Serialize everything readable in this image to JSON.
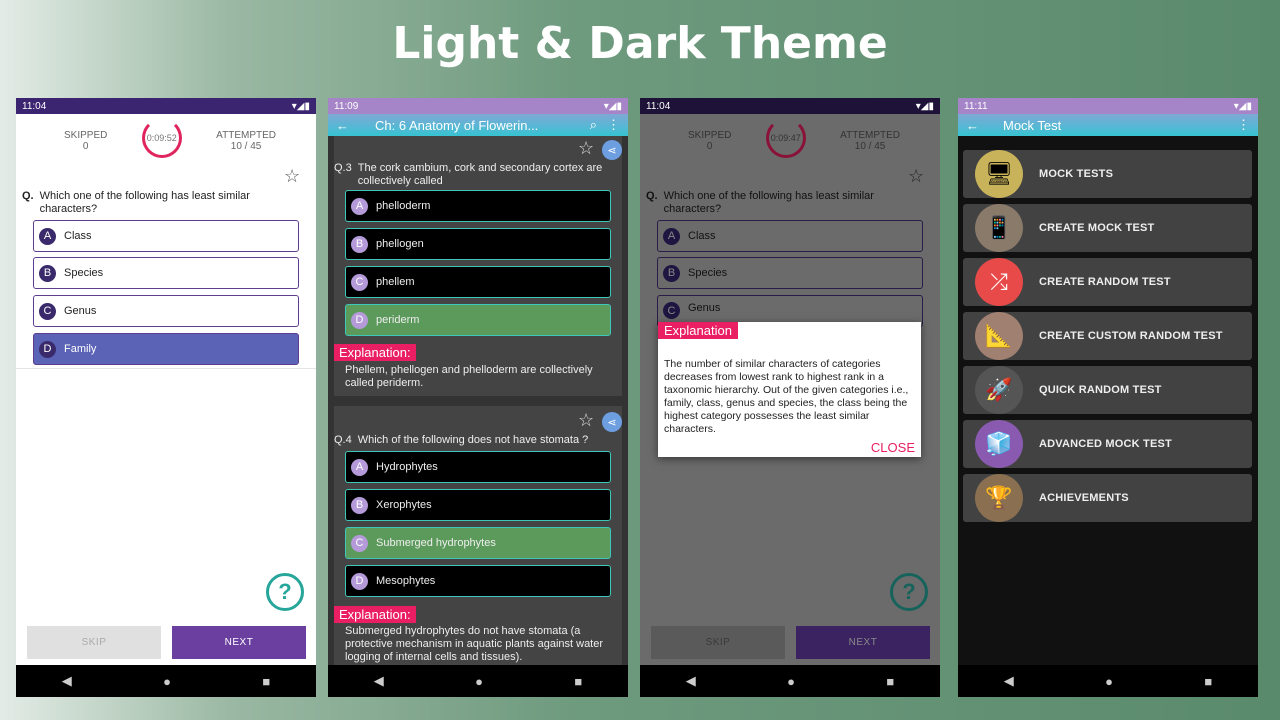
{
  "hero_title": "Light & Dark Theme",
  "screens": {
    "s1": {
      "time": "11:04",
      "skipped_label": "SKIPPED",
      "skipped_value": "0",
      "timer": "0:09:52",
      "attempted_label": "ATTEMPTED",
      "attempted_value": "10 / 45",
      "q_prefix": "Q.",
      "question": "Which one of the following has least similar characters?",
      "options": [
        {
          "letter": "A",
          "text": "Class"
        },
        {
          "letter": "B",
          "text": "Species"
        },
        {
          "letter": "C",
          "text": "Genus"
        },
        {
          "letter": "D",
          "text": "Family",
          "selected": true
        }
      ],
      "skip": "SKIP",
      "next": "NEXT",
      "help": "?"
    },
    "s2": {
      "time": "11:09",
      "title": "Ch: 6 Anatomy of Flowerin...",
      "q3": {
        "num": "Q.3",
        "text": "The cork cambium, cork and secondary cortex are collectively called",
        "options": [
          {
            "letter": "A",
            "text": "phelloderm"
          },
          {
            "letter": "B",
            "text": "phellogen"
          },
          {
            "letter": "C",
            "text": "phellem"
          },
          {
            "letter": "D",
            "text": "periderm",
            "correct": true
          }
        ],
        "explanation_label": "Explanation:",
        "explanation": "Phellem, phellogen and phelloderm are collectively called periderm."
      },
      "q4": {
        "num": "Q.4",
        "text": "Which of the following does not have stomata ?",
        "options": [
          {
            "letter": "A",
            "text": "Hydrophytes"
          },
          {
            "letter": "B",
            "text": "Xerophytes"
          },
          {
            "letter": "C",
            "text": "Submerged hydrophytes",
            "correct": true
          },
          {
            "letter": "D",
            "text": "Mesophytes"
          }
        ],
        "explanation_label": "Explanation:",
        "explanation": "Submerged hydrophytes do not have stomata (a protective mechanism in aquatic plants against water logging of internal cells and tissues)."
      }
    },
    "s3": {
      "time": "11:04",
      "skipped_label": "SKIPPED",
      "skipped_value": "0",
      "timer": "0:09:47",
      "attempted_label": "ATTEMPTED",
      "attempted_value": "10 / 45",
      "q_prefix": "Q.",
      "question": "Which one of the following has least similar characters?",
      "options": [
        {
          "letter": "A",
          "text": "Class"
        },
        {
          "letter": "B",
          "text": "Species"
        },
        {
          "letter": "C",
          "text": "Genus"
        }
      ],
      "dialog_title": "Explanation",
      "dialog_text": "The number of similar characters of categories decreases from lowest rank to highest rank in a taxonomic hierarchy. Out of the given categories i.e., family, class, genus and species, the class being the highest category possesses the least similar characters.",
      "close": "CLOSE",
      "skip": "SKIP",
      "next": "NEXT",
      "help": "?"
    },
    "s4": {
      "time": "11:11",
      "title": "Mock Test",
      "items": [
        "MOCK TESTS",
        "CREATE MOCK TEST",
        "CREATE RANDOM TEST",
        "CREATE CUSTOM RANDOM TEST",
        "QUICK RANDOM TEST",
        "ADVANCED MOCK TEST",
        "ACHIEVEMENTS"
      ]
    }
  },
  "colors": {
    "accent_pink": "#e91e63",
    "purple": "#6a3fa0",
    "teal": "#3cc7b9",
    "status_purple": "#3b2470",
    "correct_green": "#5c9a5c"
  }
}
